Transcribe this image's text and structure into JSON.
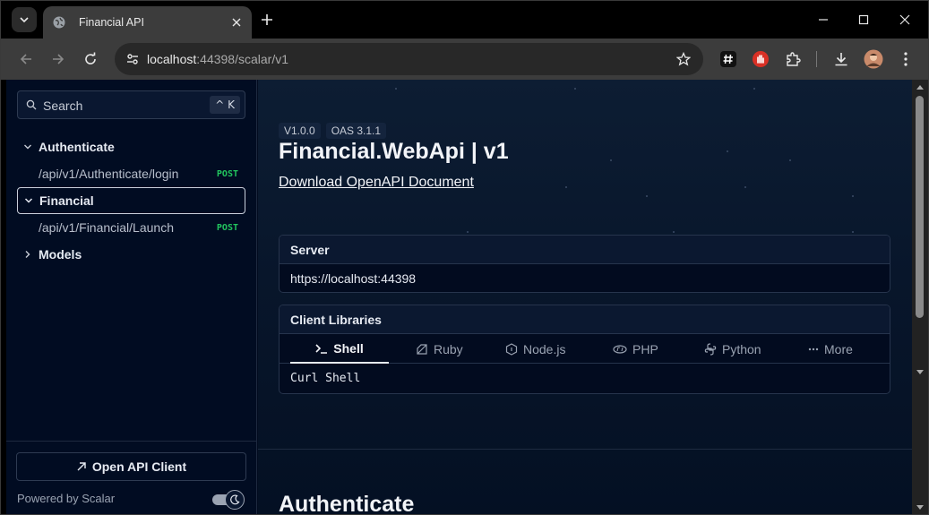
{
  "browser": {
    "tab_title": "Financial API",
    "url_host": "localhost",
    "url_rest": ":44398/scalar/v1"
  },
  "sidebar": {
    "search_placeholder": "Search",
    "search_shortcut": "^ K",
    "groups": [
      {
        "label": "Authenticate",
        "expanded": true,
        "items": [
          {
            "label": "/api/v1/Authenticate/login",
            "method": "POST"
          }
        ]
      },
      {
        "label": "Financial",
        "expanded": true,
        "active": true,
        "items": [
          {
            "label": "/api/v1/Financial/Launch",
            "method": "POST"
          }
        ]
      },
      {
        "label": "Models",
        "expanded": false
      }
    ],
    "open_client_label": "Open API Client",
    "powered_by": "Powered by Scalar"
  },
  "main": {
    "version_badge": "V1.0.0",
    "oas_badge": "OAS 3.1.1",
    "title": "Financial.WebApi | v1",
    "download_link": "Download OpenAPI Document",
    "server_label": "Server",
    "server_url": "https://localhost:44398",
    "client_libraries_label": "Client Libraries",
    "client_tabs": [
      "Shell",
      "Ruby",
      "Node.js",
      "PHP",
      "Python",
      "More"
    ],
    "active_client_tab": "Shell",
    "client_variant": "Curl Shell",
    "section_heading": "Authenticate"
  },
  "colors": {
    "accent_post": "#22c55e",
    "page_bg": "#020b1f"
  }
}
